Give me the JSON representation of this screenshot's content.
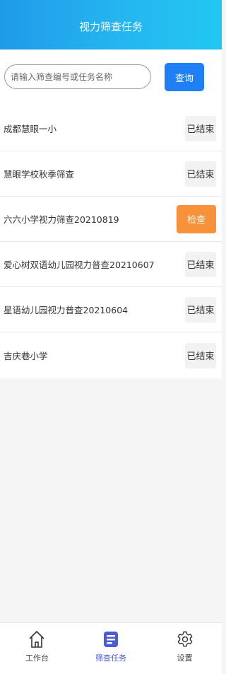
{
  "header": {
    "title": "视力筛查任务"
  },
  "search": {
    "placeholder": "请输入筛查编号或任务名称",
    "value": "",
    "button_label": "查询"
  },
  "tasks": [
    {
      "name": "成都慧眼一小",
      "status": "已结束",
      "status_type": "ended"
    },
    {
      "name": "慧眼学校秋季筛查",
      "status": "已结束",
      "status_type": "ended"
    },
    {
      "name": "六六小学视力筛查20210819",
      "status": "检查",
      "status_type": "check"
    },
    {
      "name": "爱心树双语幼儿园视力普查20210607",
      "status": "已结束",
      "status_type": "ended"
    },
    {
      "name": "星语幼儿园视力普查20210604",
      "status": "已结束",
      "status_type": "ended"
    },
    {
      "name": "吉庆巷小学",
      "status": "已结束",
      "status_type": "ended"
    }
  ],
  "tabbar": {
    "items": [
      {
        "label": "工作台",
        "icon": "home-icon",
        "active": false
      },
      {
        "label": "筛查任务",
        "icon": "task-list-icon",
        "active": true
      },
      {
        "label": "设置",
        "icon": "gear-icon",
        "active": false
      }
    ]
  },
  "colors": {
    "header_gradient_start": "#1f9ae8",
    "header_gradient_end": "#22c7f2",
    "primary_button": "#1f7ff5",
    "check_button": "#f7913a",
    "active_tab": "#4a5bd6"
  }
}
